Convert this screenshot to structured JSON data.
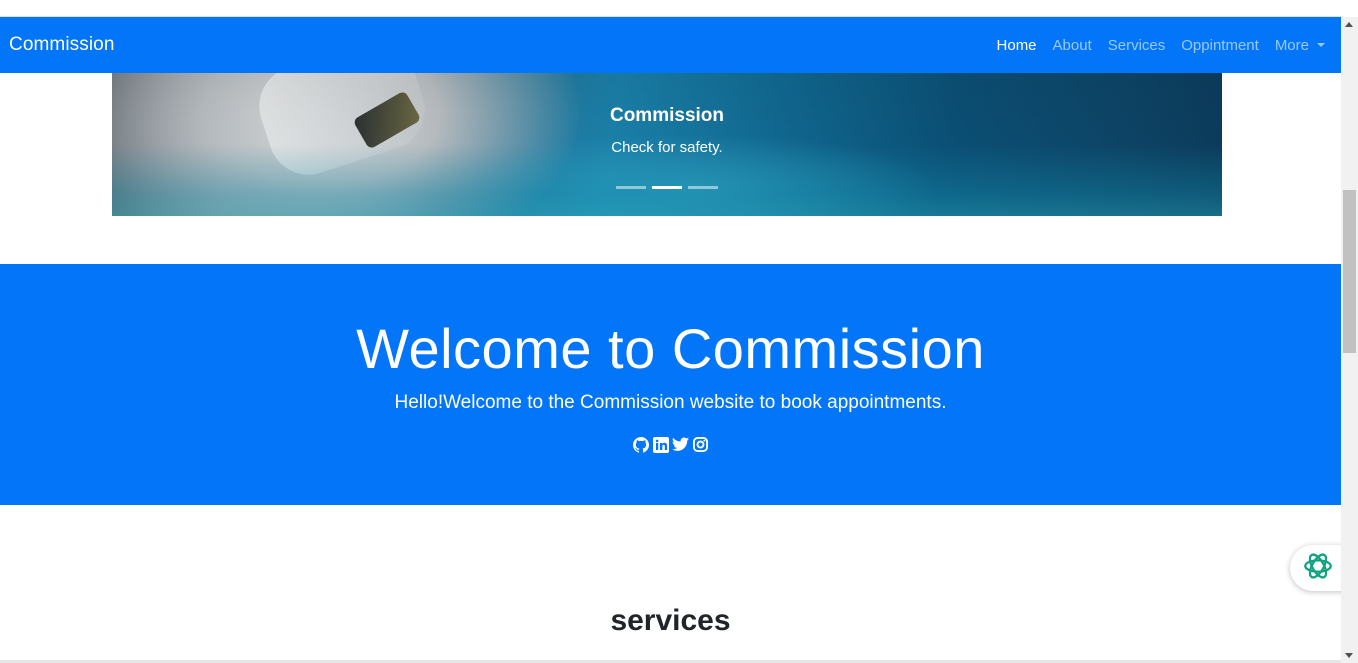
{
  "navbar": {
    "brand": "Commission",
    "links": [
      {
        "label": "Home",
        "active": true
      },
      {
        "label": "About",
        "active": false
      },
      {
        "label": "Services",
        "active": false
      },
      {
        "label": "Oppintment",
        "active": false
      },
      {
        "label": "More",
        "active": false,
        "dropdown": true
      }
    ]
  },
  "carousel": {
    "caption_title": "Commission",
    "caption_text": "Check for safety.",
    "indicators": 3,
    "active_indicator": 2
  },
  "hero": {
    "title": "Welcome to Commission",
    "subtitle": "Hello!Welcome to the Commission website to book appointments.",
    "social_icons": [
      "github-icon",
      "linkedin-icon",
      "twitter-icon",
      "instagram-icon"
    ]
  },
  "services": {
    "heading": "services"
  },
  "colors": {
    "primary": "#0275f8",
    "text_dark": "#212529",
    "assistant_icon": "#10a37f"
  }
}
